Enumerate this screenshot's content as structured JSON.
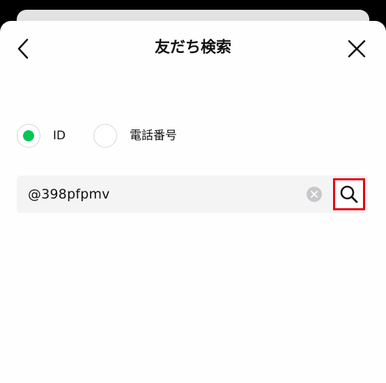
{
  "header": {
    "title": "友だち検索"
  },
  "search_type": {
    "options": [
      {
        "label": "ID",
        "selected": true
      },
      {
        "label": "電話番号",
        "selected": false
      }
    ]
  },
  "search": {
    "value": "@398pfpmv"
  },
  "icons": {
    "back": "chevron-left-icon",
    "close": "close-icon",
    "clear": "clear-circle-icon",
    "search": "search-icon"
  },
  "colors": {
    "accent": "#06c755",
    "highlight": "#e60012"
  }
}
